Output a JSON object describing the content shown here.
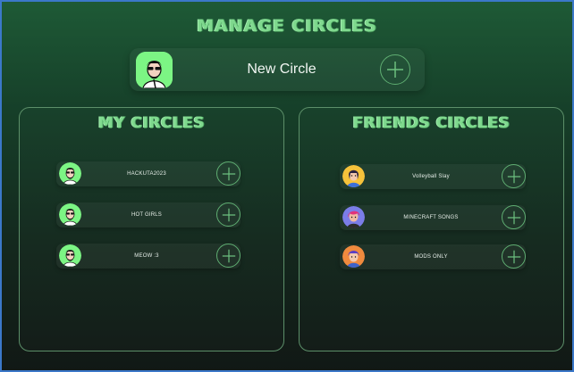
{
  "page_title": "MANAGE CIRCLES",
  "new_circle": {
    "label": "New Circle",
    "avatar_icon": "user-avatar-icon",
    "add_icon": "plus-icon"
  },
  "my_circles": {
    "title": "MY CIRCLES",
    "items": [
      {
        "label": "HACKUTA2023",
        "avatar": "user-avatar-icon"
      },
      {
        "label": "HOT GIRLS",
        "avatar": "user-avatar-icon"
      },
      {
        "label": "MEOW :3",
        "avatar": "user-avatar-icon"
      }
    ]
  },
  "friends_circles": {
    "title": "FRIENDS CIRCLES",
    "items": [
      {
        "label": "Volleyball Slay",
        "avatar": "friend-avatar-icon"
      },
      {
        "label": "MINECRAFT SONGS",
        "avatar": "friend-avatar-icon"
      },
      {
        "label": "MODS ONLY",
        "avatar": "friend-avatar-icon"
      }
    ]
  },
  "colors": {
    "accent": "#7fd98e",
    "avatar_green": "#7cf584",
    "border": "#5c8f69"
  }
}
